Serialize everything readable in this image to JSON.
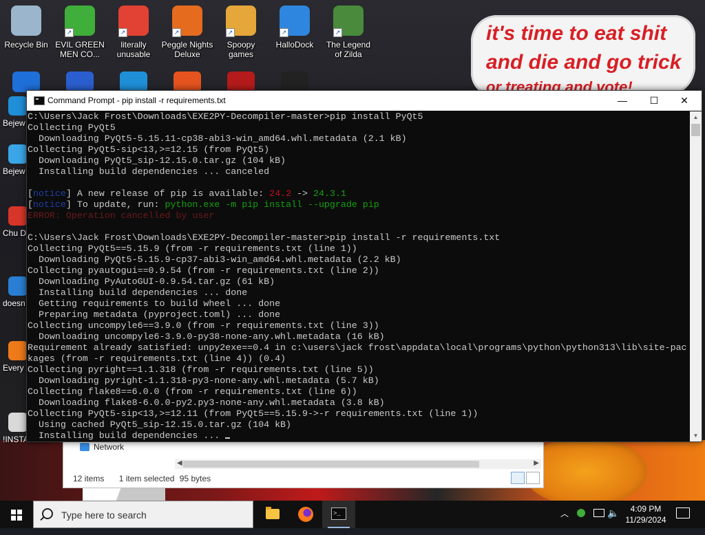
{
  "desktop": {
    "icons": [
      {
        "label": "Recycle Bin",
        "name": "recycle-bin-icon",
        "color": "#9bb6cc"
      },
      {
        "label": "EVIL GREEN MEN CO...",
        "name": "people-icon",
        "color": "#3fae3a"
      },
      {
        "label": "literally unusable",
        "name": "chrome-icon",
        "color": "#e24233"
      },
      {
        "label": "Peggle Nights Deluxe",
        "name": "peggle-icon",
        "color": "#e56b1f"
      },
      {
        "label": "Spoopy games",
        "name": "folder-icon",
        "color": "#e5a63a"
      },
      {
        "label": "HalloDock",
        "name": "windows-logo-icon",
        "color": "#2f86de"
      },
      {
        "label": "The Legend of Zilda",
        "name": "game-character-icon",
        "color": "#4a8a3c"
      }
    ],
    "side_icons": [
      {
        "label": "Bejew Del",
        "name": "bejeweled-icon",
        "color": "#1f8fd8"
      },
      {
        "label": "Bejew Del",
        "name": "bejeweled-icon-2",
        "color": "#3aa6e8"
      },
      {
        "label": "Chu Del",
        "name": "chuzzle-icon",
        "color": "#d8352a"
      },
      {
        "label": "doesn",
        "name": "edge-icon",
        "color": "#2a7fd4"
      },
      {
        "label": "Every",
        "name": "firefox-icon",
        "color": "#ee7a1a"
      },
      {
        "label": "!INSTALLIN...",
        "name": "installer-icon",
        "color": "#d9d9d9"
      }
    ],
    "sign": {
      "line1": "it's time to eat shit",
      "line2": "and die and go trick",
      "line3": "or treating and vote!"
    }
  },
  "explorer": {
    "nav_item": "Network",
    "status_items": "12 items",
    "status_selected": "1 item selected",
    "status_size": "95 bytes"
  },
  "cmd": {
    "title": "Command Prompt - pip  install -r requirements.txt",
    "controls": {
      "minimize": "—",
      "maximize": "☐",
      "close": "✕"
    },
    "lines": [
      [
        {
          "t": "C:\\Users\\Jack Frost\\Downloads\\EXE2PY-Decompiler-master>pip install PyQt5"
        }
      ],
      [
        {
          "t": "Collecting PyQt5"
        }
      ],
      [
        {
          "t": "  Downloading PyQt5-5.15.11-cp38-abi3-win_amd64.whl.metadata (2.1 kB)"
        }
      ],
      [
        {
          "t": "Collecting PyQt5-sip<13,>=12.15 (from PyQt5)"
        }
      ],
      [
        {
          "t": "  Downloading PyQt5_sip-12.15.0.tar.gz (104 kB)"
        }
      ],
      [
        {
          "t": "  Installing build dependencies ... canceled"
        }
      ],
      [
        {
          "t": ""
        }
      ],
      [
        {
          "t": "["
        },
        {
          "t": "notice",
          "c": "c-blue"
        },
        {
          "t": "] A new release of pip is available: "
        },
        {
          "t": "24.2",
          "c": "c-red"
        },
        {
          "t": " -> "
        },
        {
          "t": "24.3.1",
          "c": "c-green"
        }
      ],
      [
        {
          "t": "["
        },
        {
          "t": "notice",
          "c": "c-blue"
        },
        {
          "t": "] To update, run: "
        },
        {
          "t": "python.exe -m pip install --upgrade pip",
          "c": "c-green"
        }
      ],
      [
        {
          "t": "ERROR: Operation cancelled by user",
          "c": "c-dim"
        }
      ],
      [
        {
          "t": ""
        }
      ],
      [
        {
          "t": "C:\\Users\\Jack Frost\\Downloads\\EXE2PY-Decompiler-master>pip install -r requirements.txt"
        }
      ],
      [
        {
          "t": "Collecting PyQt5==5.15.9 (from -r requirements.txt (line 1))"
        }
      ],
      [
        {
          "t": "  Downloading PyQt5-5.15.9-cp37-abi3-win_amd64.whl.metadata (2.2 kB)"
        }
      ],
      [
        {
          "t": "Collecting pyautogui==0.9.54 (from -r requirements.txt (line 2))"
        }
      ],
      [
        {
          "t": "  Downloading PyAutoGUI-0.9.54.tar.gz (61 kB)"
        }
      ],
      [
        {
          "t": "  Installing build dependencies ... done"
        }
      ],
      [
        {
          "t": "  Getting requirements to build wheel ... done"
        }
      ],
      [
        {
          "t": "  Preparing metadata (pyproject.toml) ... done"
        }
      ],
      [
        {
          "t": "Collecting uncompyle6==3.9.0 (from -r requirements.txt (line 3))"
        }
      ],
      [
        {
          "t": "  Downloading uncompyle6-3.9.0-py38-none-any.whl.metadata (16 kB)"
        }
      ],
      [
        {
          "t": "Requirement already satisfied: unpy2exe==0.4 in c:\\users\\jack frost\\appdata\\local\\programs\\python\\python313\\lib\\site-pac"
        }
      ],
      [
        {
          "t": "kages (from -r requirements.txt (line 4)) (0.4)"
        }
      ],
      [
        {
          "t": "Collecting pyright==1.1.318 (from -r requirements.txt (line 5))"
        }
      ],
      [
        {
          "t": "  Downloading pyright-1.1.318-py3-none-any.whl.metadata (5.7 kB)"
        }
      ],
      [
        {
          "t": "Collecting flake8==6.0.0 (from -r requirements.txt (line 6))"
        }
      ],
      [
        {
          "t": "  Downloading flake8-6.0.0-py2.py3-none-any.whl.metadata (3.8 kB)"
        }
      ],
      [
        {
          "t": "Collecting PyQt5-sip<13,>=12.11 (from PyQt5==5.15.9->-r requirements.txt (line 1))"
        }
      ],
      [
        {
          "t": "  Using cached PyQt5_sip-12.15.0.tar.gz (104 kB)"
        }
      ],
      [
        {
          "t": "  Installing build dependencies ... "
        }
      ]
    ]
  },
  "taskbar": {
    "search_placeholder": "Type here to search",
    "time": "4:09 PM",
    "date": "11/29/2024"
  }
}
